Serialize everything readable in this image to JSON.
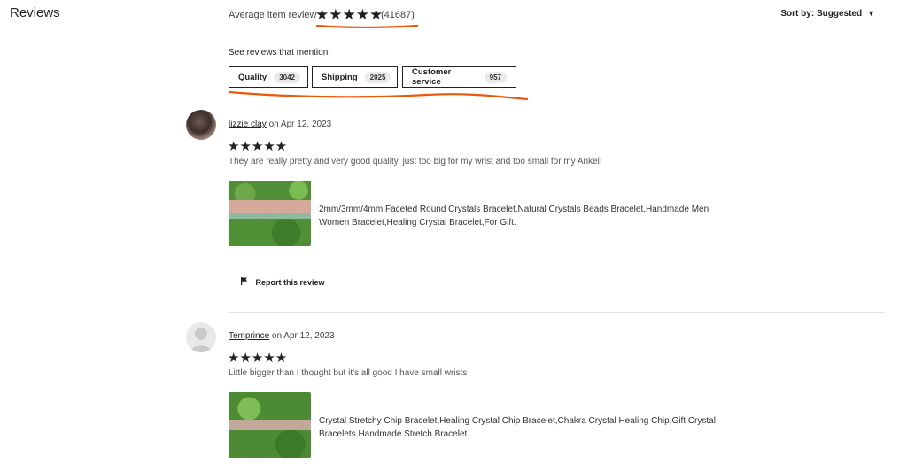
{
  "header": {
    "title": "Reviews",
    "average_label": "Average item review",
    "average_stars": "★★★★★",
    "review_count": "(41687)",
    "sort_label": "Sort by: Suggested",
    "sort_caret": "▼"
  },
  "mentions": {
    "label": "See reviews that mention:",
    "chips": [
      {
        "label": "Quality",
        "count": "3042"
      },
      {
        "label": "Shipping",
        "count": "2025"
      },
      {
        "label": "Customer service",
        "count": "957"
      }
    ]
  },
  "reviews": [
    {
      "user": "lizzie clay",
      "date": " on Apr 12, 2023",
      "stars": "★★★★★",
      "text": "They are really pretty and very good quality, just too big for my wrist and too small for my Ankel!",
      "product": "2mm/3mm/4mm Faceted Round Crystals Bracelet,Natural Crystals Beads Bracelet,Handmade Men Women Bracelet,Healing Crystal Bracelet,For Gift.",
      "report_label": "Report this review"
    },
    {
      "user": "Temprince",
      "date": " on Apr 12, 2023",
      "stars": "★★★★★",
      "text": "Little bigger than I thought but it's all good I have small wrists",
      "product": "Crystal Stretchy Chip Bracelet,Healing Crystal Chip Bracelet,Chakra Crystal Healing Chip,Gift Crystal Bracelets.Handmade Stretch Bracelet."
    }
  ],
  "colors": {
    "annotation": "#e8590c",
    "text": "#222222"
  }
}
